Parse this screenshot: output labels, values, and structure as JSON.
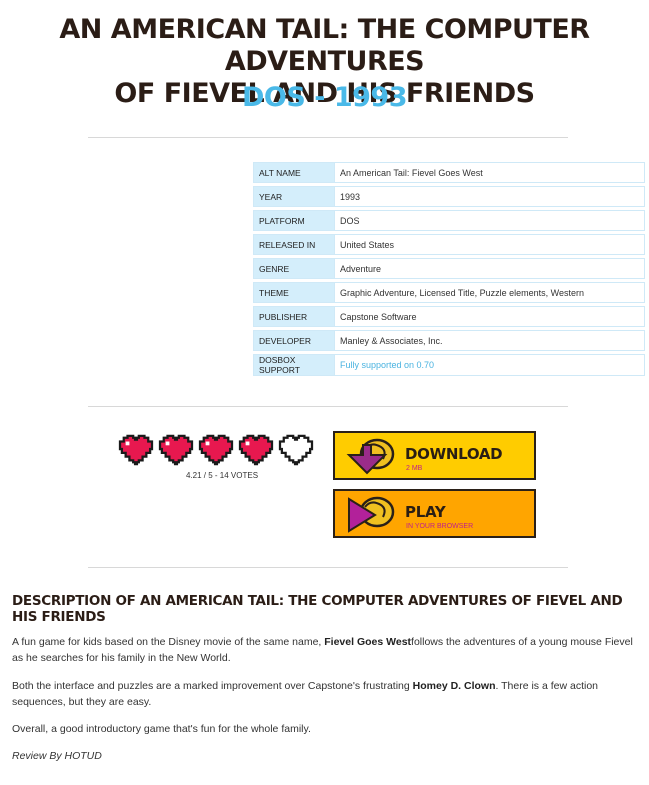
{
  "header": {
    "title_line1": "AN AMERICAN TAIL: THE COMPUTER ADVENTURES",
    "title_line2": "OF FIEVEL AND HIS FRIENDS",
    "subtitle": "DOS - 1993"
  },
  "info": [
    {
      "key": "ALT NAME",
      "value": "An American Tail: Fievel Goes West"
    },
    {
      "key": "YEAR",
      "value": "1993"
    },
    {
      "key": "PLATFORM",
      "value": "DOS"
    },
    {
      "key": "RELEASED IN",
      "value": "United States"
    },
    {
      "key": "GENRE",
      "value": "Adventure"
    },
    {
      "key": "THEME",
      "value": "Graphic Adventure, Licensed Title, Puzzle elements, Western"
    },
    {
      "key": "PUBLISHER",
      "value": "Capstone Software"
    },
    {
      "key": "DEVELOPER",
      "value": "Manley & Associates, Inc."
    },
    {
      "key": "DOSBOX SUPPORT",
      "value": "Fully supported on 0.70"
    }
  ],
  "rating": {
    "score": 4.21,
    "max": 5,
    "filled_hearts": 4,
    "votes_text": "4.21 / 5 - 14 VOTES",
    "heart_color": "#e8184f"
  },
  "buttons": {
    "download_label": "DOWNLOAD",
    "download_sub": "2 MB",
    "play_label": "PLAY",
    "play_sub": "IN YOUR BROWSER",
    "download_color": "#ffcc00",
    "play_color": "#ffa500"
  },
  "description": {
    "heading": "DESCRIPTION OF AN AMERICAN TAIL: THE COMPUTER ADVENTURES OF FIEVEL AND HIS FRIENDS",
    "p1_a": "A fun game for kids based on the Disney movie of the same name, ",
    "p1_b": "Fievel Goes West",
    "p1_c": "follows the adventures of a young mouse Fievel as he searches for his family in the New World.",
    "p2_a": "Both the interface and puzzles are a marked improvement over Capstone's frustrating ",
    "p2_b": "Homey D. Clown",
    "p2_c": ". There is a few action sequences, but they are easy.",
    "p3": "Overall, a good introductory game that's fun for the whole family.",
    "review": "Review By HOTUD"
  }
}
